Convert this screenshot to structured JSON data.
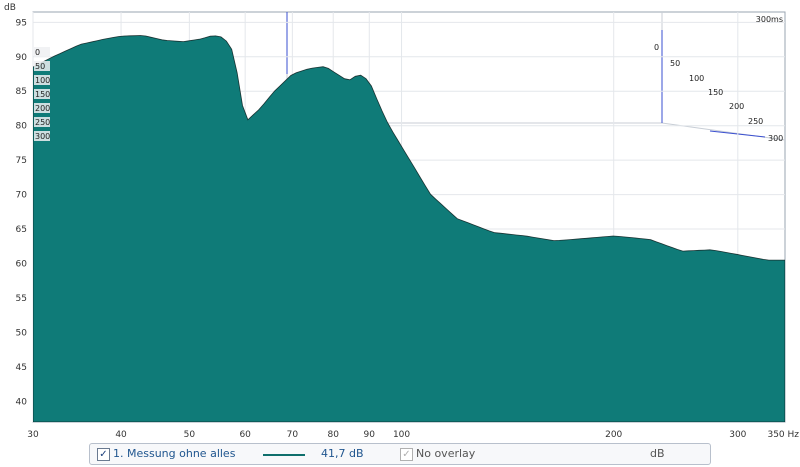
{
  "chart_data": {
    "type": "area",
    "kind": "waterfall",
    "y_unit": "dB",
    "x_unit": "Hz",
    "x_scale": "log",
    "xlim": [
      30,
      350
    ],
    "ylim": [
      37,
      96.5
    ],
    "x_ticks": [
      30,
      40,
      50,
      60,
      70,
      80,
      90,
      100,
      200,
      300
    ],
    "x_tick_labels": [
      "30",
      "40",
      "50",
      "60",
      "70",
      "80",
      "90",
      "100",
      "200",
      "300",
      "350 Hz"
    ],
    "y_ticks": [
      40,
      45,
      50,
      55,
      60,
      65,
      70,
      75,
      80,
      85,
      90,
      95
    ],
    "y_tick_labels": [
      "40",
      "45",
      "50",
      "55",
      "60",
      "65",
      "70",
      "75",
      "80",
      "85",
      "90",
      "95"
    ],
    "time_unit": "ms",
    "time_range": [
      0,
      300
    ],
    "time_ticks_left": [
      "0",
      "50",
      "100",
      "150",
      "200",
      "250",
      "300"
    ],
    "time_ticks_right": [
      "0",
      "50",
      "100",
      "150",
      "200",
      "250",
      "300"
    ],
    "time_label_top": "300ms",
    "fill_color": "#0f7b78",
    "stroke_color": "#0a1f1e",
    "grid": true,
    "first_slice": {
      "x": [
        30,
        32,
        35,
        38,
        40,
        43,
        46,
        49,
        52,
        54,
        56,
        57.5,
        58.5,
        60,
        63,
        66,
        70,
        74,
        78,
        81,
        84,
        87,
        90,
        93,
        96,
        100,
        110,
        120,
        135,
        150,
        165,
        180,
        200,
        225,
        250,
        275,
        300,
        330,
        350
      ],
      "y": [
        88.5,
        90,
        91.8,
        92.6,
        93,
        93.1,
        92.4,
        92.2,
        92.6,
        93.1,
        92.8,
        91,
        87.5,
        80.5,
        82.5,
        85,
        87.5,
        88.3,
        88.6,
        87.5,
        86.5,
        87.5,
        86.5,
        83,
        80,
        77,
        70,
        66.5,
        64.5,
        64,
        63.3,
        63.6,
        64,
        63.5,
        61.8,
        62,
        61.3,
        60.5,
        60.5
      ]
    }
  },
  "legend": {
    "series_label": "1. Messung ohne alles",
    "series_value": "41,7 dB",
    "overlay_label": "No overlay",
    "overlay_unit": "dB",
    "series_checked_glyph": "✓",
    "overlay_checked_glyph": "✓",
    "series_color": "#0f6f6c"
  }
}
